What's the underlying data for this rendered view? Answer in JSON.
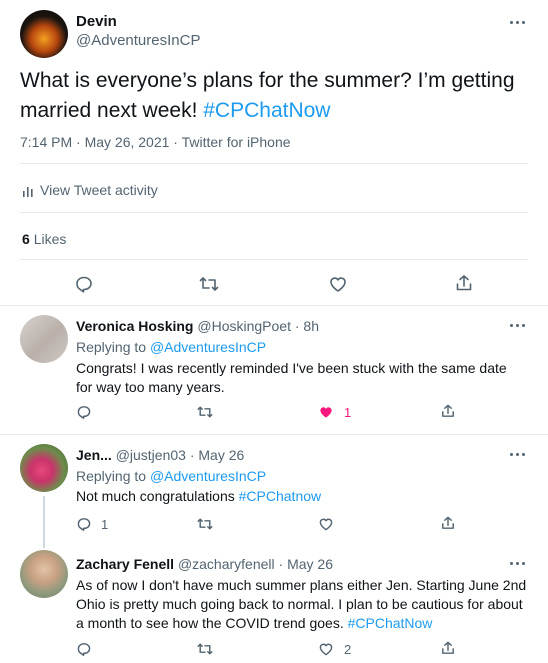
{
  "main_tweet": {
    "author_name": "Devin",
    "author_handle": "@AdventuresInCP",
    "text_plain": "What is everyone’s plans for the summer? I’m getting married next week! ",
    "hashtag": "#CPChatNow",
    "meta": "7:14 PM · May 26, 2021 · Twitter for iPhone",
    "activity_label": "View Tweet activity",
    "likes_count": "6",
    "likes_label": "Likes"
  },
  "replies": [
    {
      "author_name": "Veronica Hosking",
      "author_handle": "@HoskingPoet",
      "time": "· 8h",
      "replying_prefix": "Replying to ",
      "replying_to": "@AdventuresInCP",
      "text_line1": "Congrats! I was recently reminded I've been stuck with the same date",
      "text_line2": "for way too many years.",
      "like_count": "1",
      "liked": true
    },
    {
      "author_name": "Jen...",
      "author_handle": "@justjen03",
      "time": "· May 26",
      "replying_prefix": "Replying to ",
      "replying_to": "@AdventuresInCP",
      "text_plain": "Not much congratulations ",
      "hashtag": "#CPChatnow",
      "reply_count": "1"
    },
    {
      "author_name": "Zachary Fenell",
      "author_handle": "@zacharyfenell",
      "time": "· May 26",
      "text_line1": "As of now I don't have much summer plans either Jen. Starting June 2nd",
      "text_line2": "Ohio is pretty much going back to normal. I plan to be cautious for about",
      "text_line3_plain": "a month to see how the COVID trend goes. ",
      "hashtag": "#CPChatNow",
      "like_count": "2"
    }
  ],
  "colors": {
    "accent": "#1d9bf0",
    "like_red": "#f91880",
    "muted": "#536471",
    "divider": "#e6ecf0"
  },
  "icons": [
    "reply-icon",
    "retweet-icon",
    "like-icon",
    "share-icon",
    "more-icon",
    "activity-icon"
  ]
}
